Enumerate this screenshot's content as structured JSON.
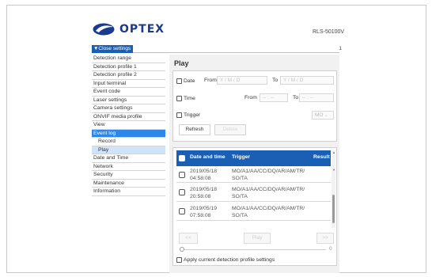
{
  "header": {
    "logo_text": "OPTEX",
    "model": "RLS-50100V"
  },
  "topbar": {
    "close_label": "▼Close settings",
    "page_number": "1"
  },
  "sidebar": {
    "items": [
      {
        "label": "Detection range"
      },
      {
        "label": "Detection profile 1"
      },
      {
        "label": "Detection profile 2"
      },
      {
        "label": "Input terminal"
      },
      {
        "label": "Event code"
      },
      {
        "label": "Laser settings"
      },
      {
        "label": "Camera settings"
      },
      {
        "label": "ONVIF media profile"
      },
      {
        "label": "View"
      },
      {
        "label": "Event log"
      },
      {
        "label": "Record"
      },
      {
        "label": "Play"
      },
      {
        "label": "Date and Time"
      },
      {
        "label": "Network"
      },
      {
        "label": "Security"
      },
      {
        "label": "Maintenance"
      },
      {
        "label": "Information"
      }
    ]
  },
  "main": {
    "title": "Play",
    "search": {
      "date_label": "Date",
      "from_label": "From",
      "date_from_placeholder": "Y / M / D",
      "to_label": "To",
      "date_to_placeholder": "Y / M / D",
      "time_label": "Time",
      "time_from_label": "From",
      "time_from_placeholder": "-- : --",
      "time_to_label": "To",
      "time_to_placeholder": "-- : --",
      "trigger_label": "Trigger",
      "trigger_value": "MO",
      "refresh_label": "Refresh",
      "delete_label": "Delete"
    },
    "table": {
      "columns": [
        "Date and time",
        "Trigger",
        "Result"
      ],
      "rows": [
        {
          "date": "2019/05/18",
          "time": "04:58:08",
          "trigger_1": "MO/A1/AA/CC/DQ/AR/AM/TR/",
          "trigger_2": "SO/TA"
        },
        {
          "date": "2019/05/18",
          "time": "20:58:08",
          "trigger_1": "MO/A1/AA/CC/DQ/AR/AM/TR/",
          "trigger_2": "SO/TA"
        },
        {
          "date": "2019/05/19",
          "time": "07:58:08",
          "trigger_1": "MO/A1/AA/CC/DQ/AR/AM/TR/",
          "trigger_2": "SO/TA"
        }
      ]
    },
    "player": {
      "prev_label": "<<",
      "play_label": "Play",
      "next_label": ">>",
      "position_value": "0"
    },
    "apply_label": "Apply current detection profile settings"
  },
  "colors": {
    "brand": "#1b3a8c",
    "accent": "#1a5fb4",
    "selected": "#2e86e8"
  }
}
